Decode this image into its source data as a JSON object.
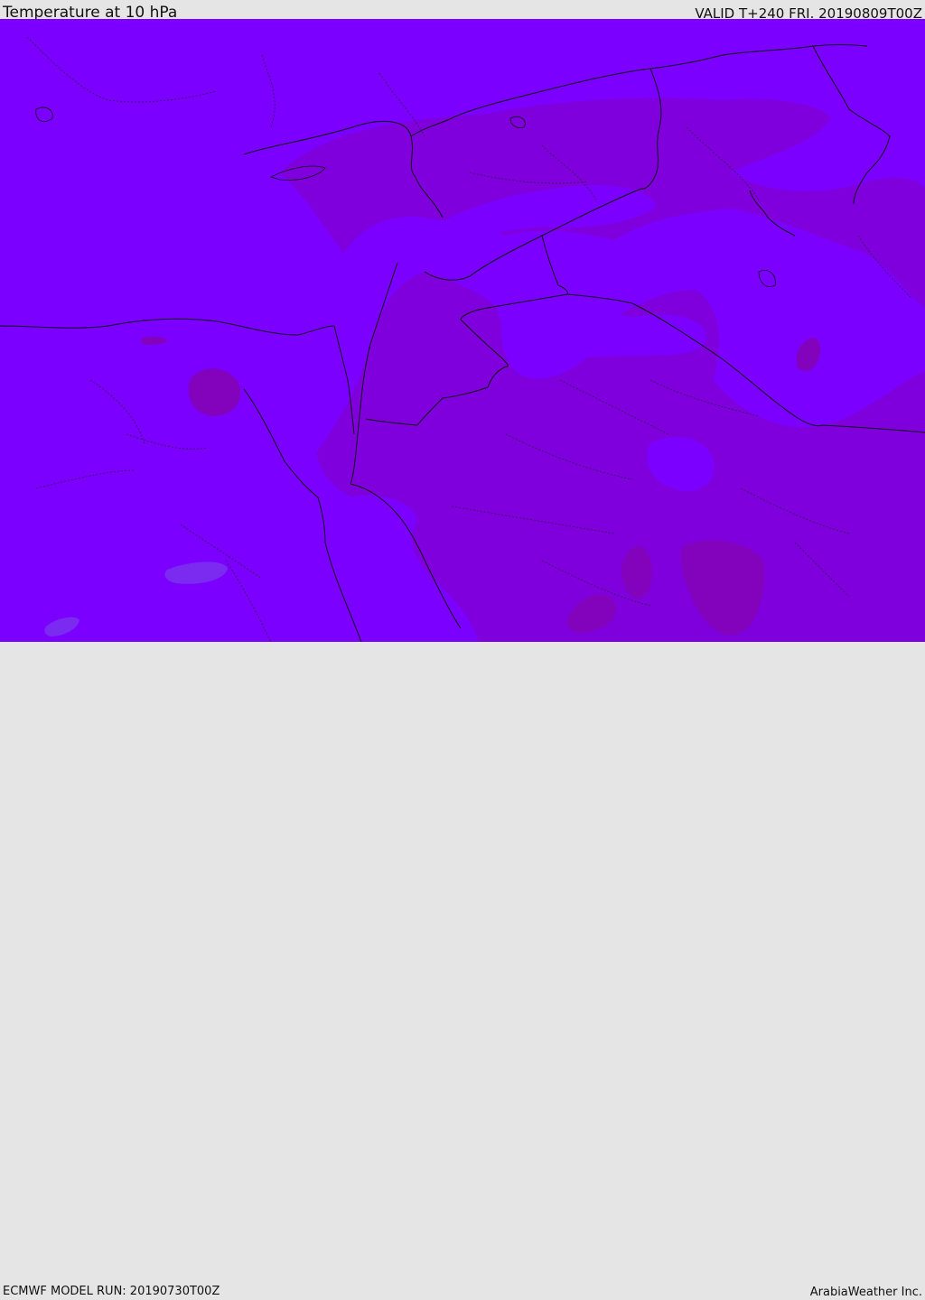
{
  "header": {
    "title": "Temperature at 10 hPa",
    "valid": "VALID T+240 FRI. 20190809T00Z"
  },
  "footer": {
    "model_run": "ECMWF MODEL RUN: 20190730T00Z",
    "credit": "ArabiaWeather Inc."
  },
  "map": {
    "field": "Temperature",
    "level": "10 hPa",
    "colors": {
      "base": "#7b00ff",
      "warm": "#7f00dd",
      "warmer": "#8303bd",
      "cool": "#7b2bf0",
      "border": "#111111"
    }
  }
}
